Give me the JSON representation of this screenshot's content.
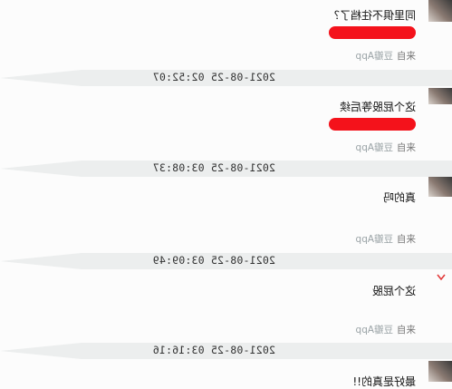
{
  "comments": [
    {
      "text": "同里俱不往档了？",
      "redacted": true,
      "source_label": "来自",
      "source_app": "豆瓣App"
    },
    {
      "text": "这个屁股等后续",
      "redacted": true,
      "source_label": "来自",
      "source_app": "豆瓣App"
    },
    {
      "text": "真的吗",
      "redacted": false,
      "source_label": "来自",
      "source_app": "豆瓣App"
    },
    {
      "text": "这个屁股",
      "redacted": false,
      "source_label": "来自",
      "source_app": "豆瓣App"
    },
    {
      "text": "最好是真的!!"
    }
  ],
  "timestamps": [
    "2021-08-25 02:52:07",
    "2021-08-25 03:08:37",
    "2021-08-25 03:09:49",
    "2021-08-25 03:16:16"
  ],
  "colors": {
    "redaction": "#f4121b",
    "timebar": "#eceeee",
    "source_app": "#9aa3a6"
  }
}
